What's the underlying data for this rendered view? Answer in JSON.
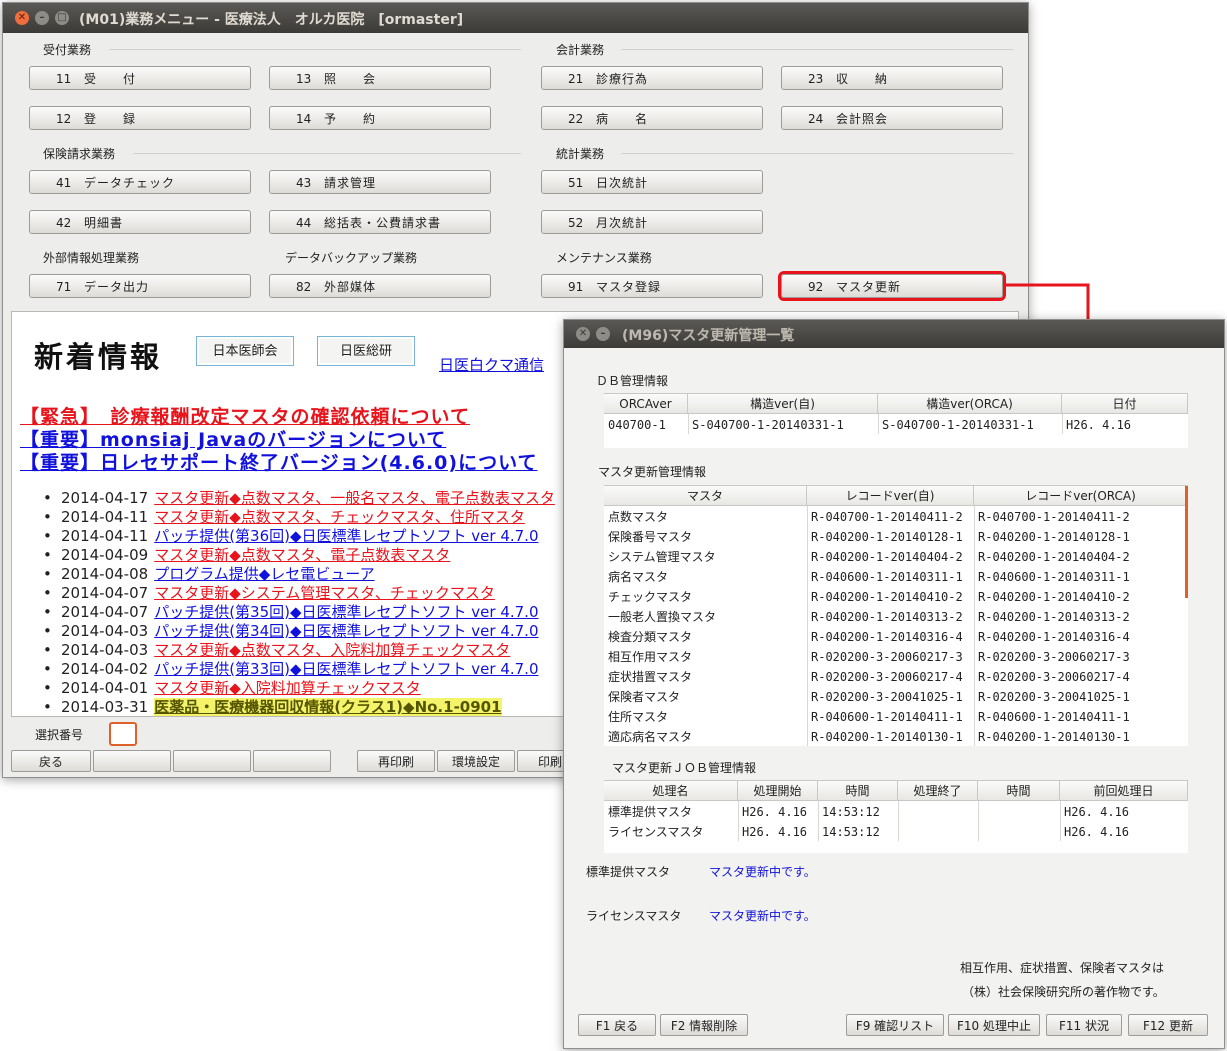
{
  "main_window": {
    "title": "(M01)業務メニュー - 医療法人　オルカ医院　[ormaster]",
    "groups": {
      "uketsuke": "受付業務",
      "kaikei": "会計業務",
      "hoken": "保険請求業務",
      "toukei": "統計業務",
      "gaibu": "外部情報処理業務",
      "backup": "データバックアップ業務",
      "maint": "メンテナンス業務"
    },
    "buttons": [
      {
        "num": "11",
        "label": "受　　付"
      },
      {
        "num": "13",
        "label": "照　　会"
      },
      {
        "num": "21",
        "label": "診療行為"
      },
      {
        "num": "23",
        "label": "収　　納"
      },
      {
        "num": "12",
        "label": "登　　録"
      },
      {
        "num": "14",
        "label": "予　　約"
      },
      {
        "num": "22",
        "label": "病　　名"
      },
      {
        "num": "24",
        "label": "会計照会"
      },
      {
        "num": "41",
        "label": "データチェック"
      },
      {
        "num": "43",
        "label": "請求管理"
      },
      {
        "num": "51",
        "label": "日次統計"
      },
      {
        "num": "42",
        "label": "明細書"
      },
      {
        "num": "44",
        "label": "総括表・公費請求書"
      },
      {
        "num": "52",
        "label": "月次統計"
      },
      {
        "num": "71",
        "label": "データ出力"
      },
      {
        "num": "82",
        "label": "外部媒体"
      },
      {
        "num": "91",
        "label": "マスタ登録"
      },
      {
        "num": "92",
        "label": "マスタ更新"
      }
    ],
    "news": {
      "title": "新着情報",
      "btn_ishikai": "日本医師会",
      "btn_isoken": "日医総研",
      "link_kuma": "日医白クマ通信",
      "urgent_prefix": "【緊急】",
      "urgent_text": "　診療報酬改定マスタの確認依頼について",
      "important1": "【重要】monsiaj Javaのバージョンについて",
      "important2": "【重要】日レセサポート終了バージョン(4.6.0)について",
      "items": [
        {
          "date": "2014-04-17",
          "text": "マスタ更新◆点数マスタ、一般名マスタ、電子点数表マスタ",
          "kind": "red"
        },
        {
          "date": "2014-04-11",
          "text": "マスタ更新◆点数マスタ、チェックマスタ、住所マスタ",
          "kind": "red"
        },
        {
          "date": "2014-04-11",
          "text": "パッチ提供(第36回)◆日医標準レセプトソフト ver 4.7.0",
          "kind": "blue"
        },
        {
          "date": "2014-04-09",
          "text": "マスタ更新◆点数マスタ、電子点数表マスタ",
          "kind": "red"
        },
        {
          "date": "2014-04-08",
          "text": "プログラム提供◆レセ電ビューア",
          "kind": "blue"
        },
        {
          "date": "2014-04-07",
          "text": "マスタ更新◆システム管理マスタ、チェックマスタ",
          "kind": "red"
        },
        {
          "date": "2014-04-07",
          "text": "パッチ提供(第35回)◆日医標準レセプトソフト ver 4.7.0",
          "kind": "blue"
        },
        {
          "date": "2014-04-03",
          "text": "パッチ提供(第34回)◆日医標準レセプトソフト ver 4.7.0",
          "kind": "blue"
        },
        {
          "date": "2014-04-03",
          "text": "マスタ更新◆点数マスタ、入院料加算チェックマスタ",
          "kind": "red"
        },
        {
          "date": "2014-04-02",
          "text": "パッチ提供(第33回)◆日医標準レセプトソフト ver 4.7.0",
          "kind": "blue"
        },
        {
          "date": "2014-04-01",
          "text": "マスタ更新◆入院料加算チェックマスタ",
          "kind": "red"
        },
        {
          "date": "2014-03-31",
          "text": "医薬品・医療機器回収情報(クラス1)◆No.1-0901",
          "kind": "hl"
        }
      ]
    },
    "select_label": "選択番号",
    "select_value": "",
    "bottom_buttons": [
      "戻る",
      "",
      "",
      "",
      "再印刷",
      "環境設定",
      "印刷削"
    ]
  },
  "sub_window": {
    "title": "(M96)マスタ更新管理一覧",
    "db_section": "ＤＢ管理情報",
    "db_headers": [
      "ORCAver",
      "構造ver(自)",
      "構造ver(ORCA)",
      "日付"
    ],
    "db_row": [
      "040700-1",
      "S-040700-1-20140331-1",
      "S-040700-1-20140331-1",
      "H26. 4.16"
    ],
    "master_section": "マスタ更新管理情報",
    "master_headers": [
      "マスタ",
      "レコードver(自)",
      "レコードver(ORCA)"
    ],
    "master_rows": [
      [
        "点数マスタ",
        "R-040700-1-20140411-2",
        "R-040700-1-20140411-2"
      ],
      [
        "保険番号マスタ",
        "R-040200-1-20140128-1",
        "R-040200-1-20140128-1"
      ],
      [
        "システム管理マスタ",
        "R-040200-1-20140404-2",
        "R-040200-1-20140404-2"
      ],
      [
        "病名マスタ",
        "R-040600-1-20140311-1",
        "R-040600-1-20140311-1"
      ],
      [
        "チェックマスタ",
        "R-040200-1-20140410-2",
        "R-040200-1-20140410-2"
      ],
      [
        "一般老人置換マスタ",
        "R-040200-1-20140313-2",
        "R-040200-1-20140313-2"
      ],
      [
        "検査分類マスタ",
        "R-040200-1-20140316-4",
        "R-040200-1-20140316-4"
      ],
      [
        "相互作用マスタ",
        "R-020200-3-20060217-3",
        "R-020200-3-20060217-3"
      ],
      [
        "症状措置マスタ",
        "R-020200-3-20060217-4",
        "R-020200-3-20060217-4"
      ],
      [
        "保険者マスタ",
        "R-020200-3-20041025-1",
        "R-020200-3-20041025-1"
      ],
      [
        "住所マスタ",
        "R-040600-1-20140411-1",
        "R-040600-1-20140411-1"
      ],
      [
        "適応病名マスタ",
        "R-040200-1-20140130-1",
        "R-040200-1-20140130-1"
      ]
    ],
    "job_section": "マスタ更新ＪＯＢ管理情報",
    "job_headers": [
      "処理名",
      "処理開始",
      "時間",
      "処理終了",
      "時間",
      "前回処理日"
    ],
    "job_rows": [
      [
        "標準提供マスタ",
        "H26. 4.16",
        "14:53:12",
        "",
        "",
        "H26. 4.16"
      ],
      [
        "ライセンスマスタ",
        "H26. 4.16",
        "14:53:12",
        "",
        "",
        "H26. 4.16"
      ]
    ],
    "status": [
      {
        "label": "標準提供マスタ",
        "msg": "マスタ更新中です。"
      },
      {
        "label": "ライセンスマスタ",
        "msg": "マスタ更新中です。"
      }
    ],
    "note1": "相互作用、症状措置、保険者マスタは",
    "note2": "（株）社会保険研究所の著作物です。",
    "fkeys": [
      "F1 戻る",
      "F2 情報削除",
      "F9 確認リスト",
      "F10 処理中止",
      "F11 状況",
      "F12 更新"
    ]
  },
  "colors": {
    "accent_red": "#e8141c",
    "link_blue": "#1111dd",
    "highlight": "#f4f46a",
    "titlebar": "#3c3b37"
  }
}
